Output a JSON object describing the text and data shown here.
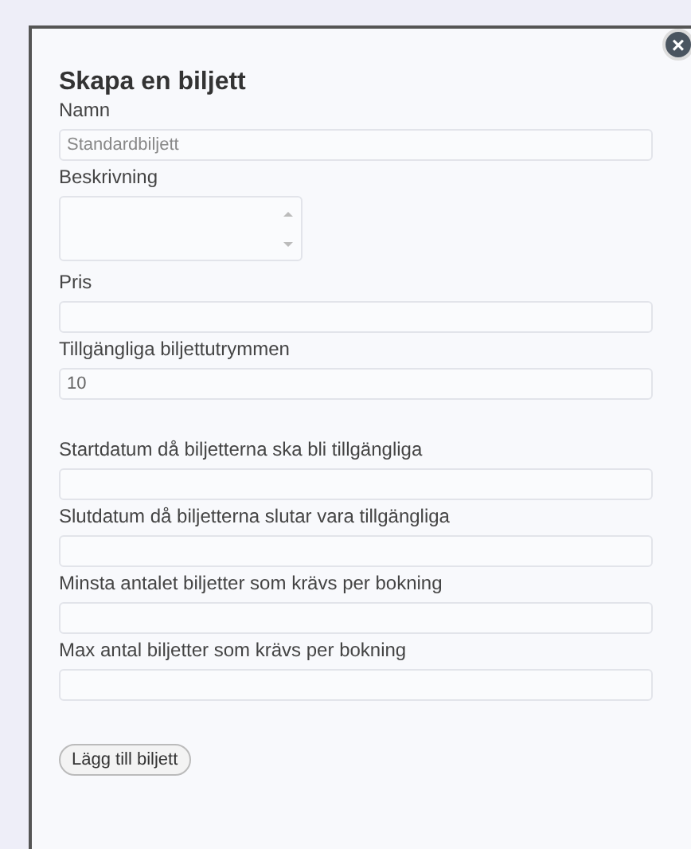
{
  "dialog": {
    "title": "Skapa en biljett",
    "close_icon": "×"
  },
  "fields": [
    {
      "kind": "text",
      "label": "Namn",
      "placeholder": "Standardbiljett"
    },
    {
      "kind": "textarea",
      "label": "Beskrivning"
    },
    {
      "kind": "text",
      "label": "Pris"
    },
    {
      "kind": "text",
      "label": "Tillgängliga biljettutrymmen",
      "value": "10"
    },
    {
      "kind": "spacer"
    },
    {
      "kind": "text",
      "label": "Startdatum då biljetterna ska bli tillgängliga"
    },
    {
      "kind": "text",
      "label": "Slutdatum då biljetterna slutar vara tillgängliga"
    },
    {
      "kind": "text",
      "label": "Minsta antalet biljetter som krävs per bokning"
    },
    {
      "kind": "text",
      "label": "Max antal biljetter som krävs per bokning"
    }
  ],
  "buttons": [
    "Lägg till biljett"
  ]
}
